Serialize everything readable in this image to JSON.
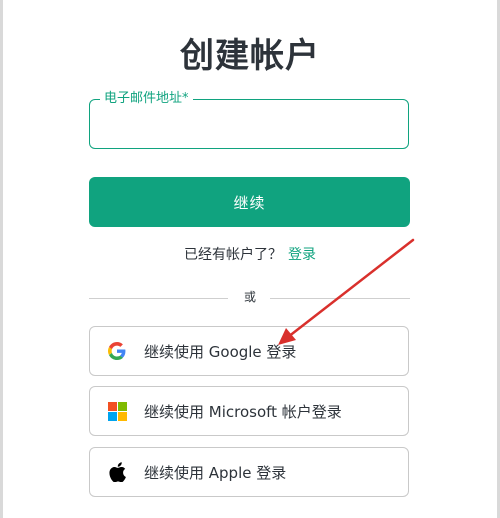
{
  "page": {
    "title": "创建帐户"
  },
  "email": {
    "label": "电子邮件地址*",
    "value": "",
    "placeholder": ""
  },
  "continue_button": {
    "label": "继续"
  },
  "login_prompt": {
    "text": "已经有帐户了？",
    "link_label": "登录"
  },
  "divider": {
    "text": "或"
  },
  "social": {
    "google": {
      "label": "继续使用 Google 登录",
      "icon": "google-icon"
    },
    "microsoft": {
      "label": "继续使用 Microsoft 帐户登录",
      "icon": "microsoft-icon"
    },
    "apple": {
      "label": "继续使用 Apple 登录",
      "icon": "apple-icon"
    }
  },
  "colors": {
    "accent": "#10a37f",
    "arrow": "#d9302c",
    "ms_red": "#f25022",
    "ms_green": "#7fba00",
    "ms_blue": "#00a4ef",
    "ms_yellow": "#ffb900"
  }
}
